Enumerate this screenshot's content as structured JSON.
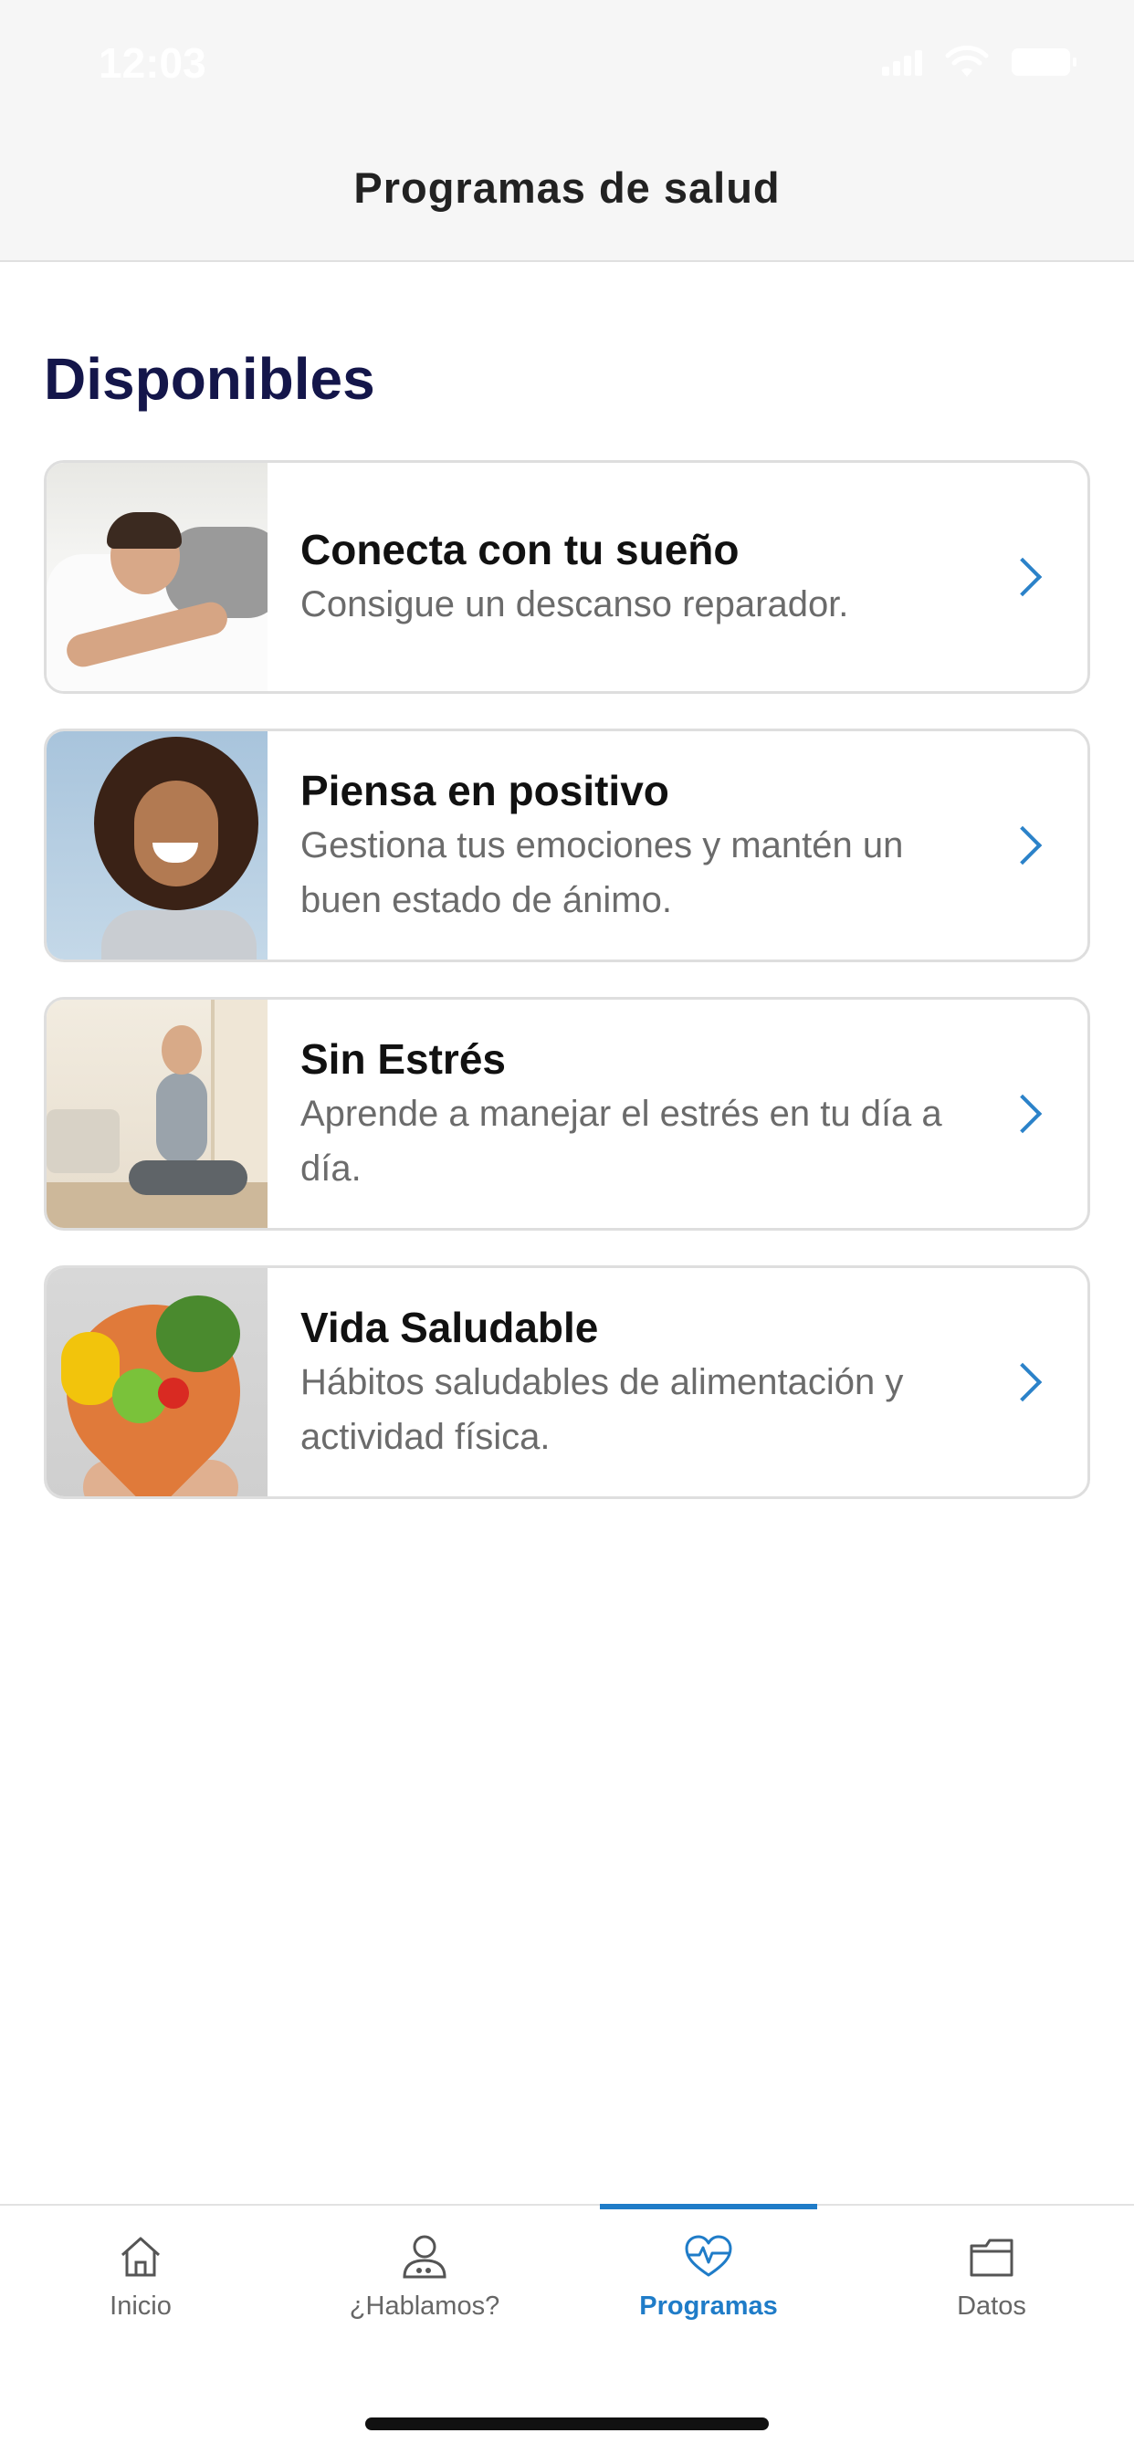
{
  "status_bar": {
    "time": "12:03"
  },
  "header": {
    "title": "Programas de salud"
  },
  "section": {
    "title": "Disponibles"
  },
  "programs": [
    {
      "title": "Conecta con tu sueño",
      "description": "Consigue un descanso reparador.",
      "image": "sleeping-man-photo",
      "icon": "chevron-right-icon"
    },
    {
      "title": "Piensa en positivo",
      "description": "Gestiona tus emociones y mantén un buen estado de ánimo.",
      "image": "smiling-woman-photo",
      "icon": "chevron-right-icon"
    },
    {
      "title": "Sin Estrés",
      "description": "Aprende a manejar el estrés en tu día a día.",
      "image": "woman-meditating-photo",
      "icon": "chevron-right-icon"
    },
    {
      "title": "Vida Saludable",
      "description": "Hábitos saludables de alimentación y actividad física.",
      "image": "healthy-food-heart-photo",
      "icon": "chevron-right-icon"
    }
  ],
  "tab_bar": {
    "items": [
      {
        "label": "Inicio",
        "icon": "home-icon",
        "active": false
      },
      {
        "label": "¿Hablamos?",
        "icon": "person-chat-icon",
        "active": false
      },
      {
        "label": "Programas",
        "icon": "heart-pulse-icon",
        "active": true
      },
      {
        "label": "Datos",
        "icon": "folder-icon",
        "active": false
      }
    ]
  },
  "colors": {
    "accent": "#1f7cc8",
    "section_title": "#14164a",
    "card_border": "#dedede",
    "header_bg": "#f6f6f6"
  }
}
